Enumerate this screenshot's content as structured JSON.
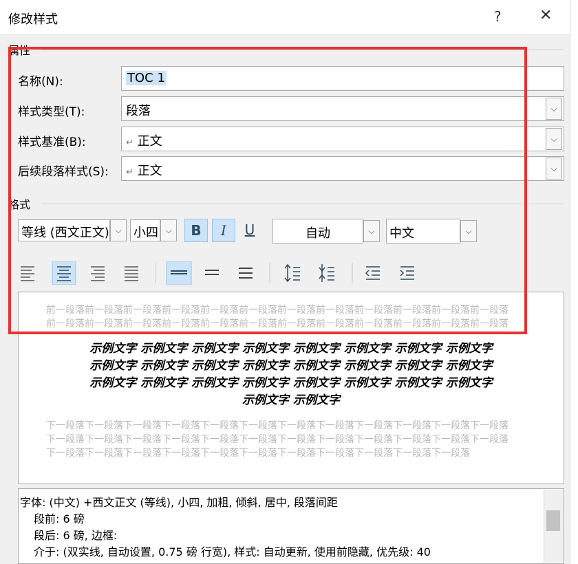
{
  "dialog": {
    "title": "修改样式",
    "help_icon": "?",
    "close_icon": "✕"
  },
  "properties": {
    "group_label": "属性",
    "name_label": "名称(N):",
    "name_value": "TOC 1",
    "type_label": "样式类型(T):",
    "type_value": "段落",
    "base_label": "样式基准(B):",
    "base_value": "正文",
    "next_label": "后续段落样式(S):",
    "next_value": "正文",
    "para_mark": "↵"
  },
  "format": {
    "group_label": "格式",
    "font": "等线 (西文正文)",
    "size": "小四",
    "bold": "B",
    "italic": "I",
    "underline": "U",
    "color": "自动",
    "script": "中文"
  },
  "preview": {
    "before": "前一段落前一段落前一段落前一段落前一段落前一段落前一段落前一段落前一段落前一段落前一段落前一段落前一段落前一段落前一段落前一段落前一段落前一段落前一段落前一段落前一段落前一段落前一段落前一段落",
    "sample_lines": [
      "示例文字 示例文字 示例文字 示例文字 示例文字 示例文字 示例文字 示例文字",
      "示例文字 示例文字 示例文字 示例文字 示例文字 示例文字 示例文字 示例文字",
      "示例文字 示例文字 示例文字 示例文字 示例文字 示例文字 示例文字 示例文字",
      "示例文字 示例文字"
    ],
    "after": "下一段落下一段落下一段落下一段落下一段落下一段落下一段落下一段落下一段落下一段落下一段落下一段落下一段落下一段落下一段落下一段落下一段落下一段落下一段落下一段落下一段落下一段落下一段落下一段落下一段落下一段落下一段落下一段落下一段落下一段落下一段落下一段落下一段落下一段落下一段落"
  },
  "description": {
    "line1": "字体: (中文) +西文正文 (等线), 小四, 加粗, 倾斜, 居中, 段落间距",
    "line2": "段前: 6 磅",
    "line3": "段后: 6 磅, 边框:",
    "line4": "介于: (双实线, 自动设置,  0.75 磅 行宽), 样式: 自动更新, 使用前隐藏, 优先级: 40"
  },
  "colors": {
    "highlight": "#e53333",
    "selection": "#cde3f7"
  }
}
